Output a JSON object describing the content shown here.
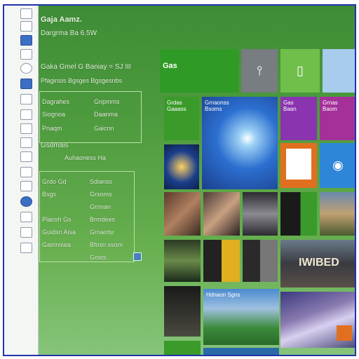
{
  "panel": {
    "title": "Gaja Aamz.",
    "subtitle": "Dargrma Ba 6.5W",
    "header_row": "Gaka Gmel G Baniay = SJ III",
    "sub_header": "Pfaginsis Bgsges Bgsgesnbs",
    "rows": [
      {
        "left": "Dagrahes",
        "right": "Gnpmms"
      },
      {
        "left": "Siognoa",
        "right": "Daanma"
      },
      {
        "left": "Pnaqm",
        "right": "Gaicnn"
      }
    ],
    "section2_title": "Gsdmais",
    "section2_line": "Auhaoness Ha",
    "section3": [
      {
        "left": "Grdo Gd",
        "right": "Sdianss"
      },
      {
        "left": "Bsgs",
        "right": "Grsoms"
      },
      {
        "left": "",
        "right": "Grnnan"
      },
      {
        "left": "Plaosh Gs",
        "right": "Brmdees"
      },
      {
        "left": "Guidsn Aisa",
        "right": "Grnaotsr"
      },
      {
        "left": "Gamnisea",
        "right": "Bfosn ssom"
      },
      {
        "left": "",
        "right": "Gosts"
      }
    ]
  },
  "tiles": [
    {
      "id": "tile-store",
      "label": "Gas"
    },
    {
      "id": "tile-photos",
      "label": ""
    },
    {
      "id": "tile-docs",
      "label": ""
    },
    {
      "id": "tile-weather",
      "label": "Grdas\nGaaass"
    },
    {
      "id": "tile-news",
      "label": "Grnaonss\nBsoms"
    },
    {
      "id": "tile-mail",
      "label": "Gas\nBaan"
    },
    {
      "id": "tile-cal",
      "label": "Grnas\nBaom"
    },
    {
      "id": "tile-hero",
      "label": "Hdnaon Sgns"
    },
    {
      "id": "tile-media",
      "label": ""
    },
    {
      "id": "tile-ie",
      "label": ""
    },
    {
      "id": "tile-movie",
      "label": "IWIBED"
    },
    {
      "id": "tile-orange",
      "label": ""
    }
  ],
  "colors": {
    "accent": "#3a6fc4",
    "tile_green": "#3a9a2a",
    "tile_gray": "#777d80",
    "tile_purple": "#8a34b0",
    "tile_blue": "#2c6fd0",
    "tile_orange": "#e07020",
    "frame_border": "#2233aa"
  }
}
